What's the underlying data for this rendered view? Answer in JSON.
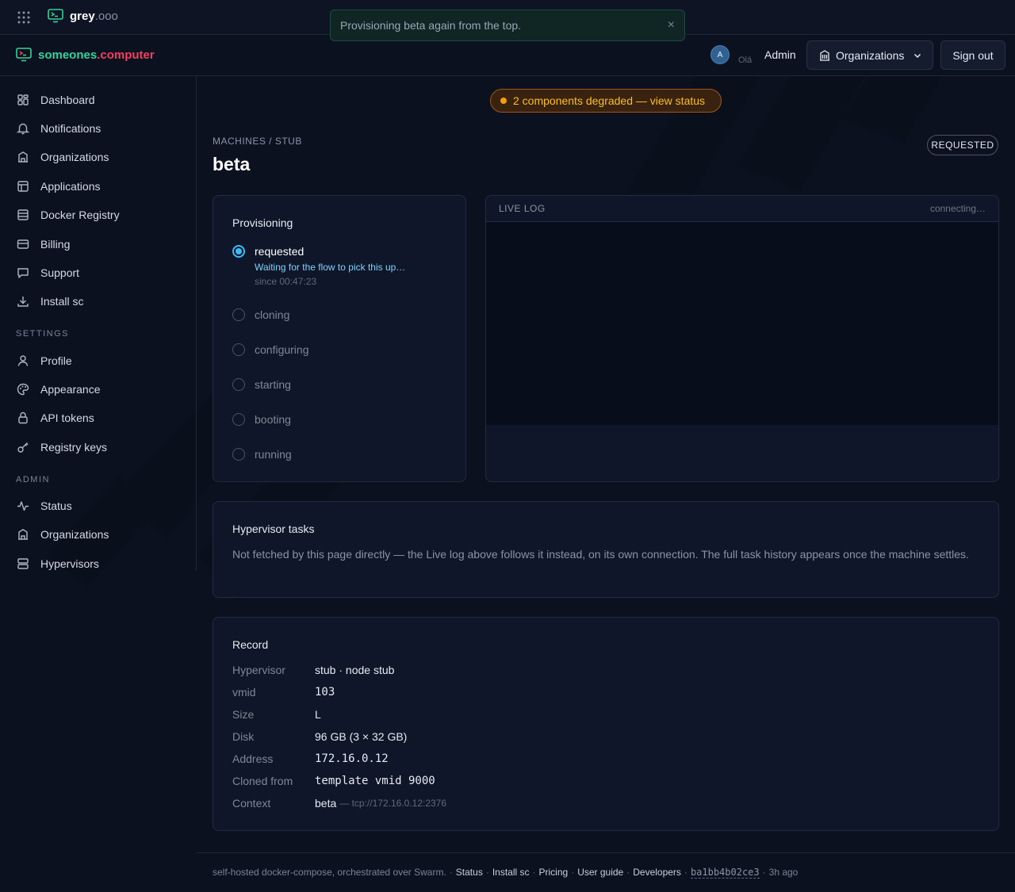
{
  "topbar": {
    "brand_name": "grey",
    "brand_ext": ".ooo",
    "toast_message": "Provisioning beta again from the top.",
    "toast_close": "×"
  },
  "header": {
    "brand_name": "someones",
    "brand_tld": ".computer",
    "avatar_initial": "A",
    "greeting": "Olá",
    "user_label": "Admin",
    "org_button": "Organizations",
    "signout_button": "Sign out"
  },
  "sidebar": {
    "items": [
      {
        "label": "Dashboard",
        "icon": "dashboard-icon"
      },
      {
        "label": "Notifications",
        "icon": "bell-icon"
      },
      {
        "label": "Organizations",
        "icon": "building-icon"
      },
      {
        "label": "Applications",
        "icon": "layout-icon"
      },
      {
        "label": "Docker Registry",
        "icon": "registry-icon"
      },
      {
        "label": "Billing",
        "icon": "card-icon"
      },
      {
        "label": "Support",
        "icon": "chat-icon"
      },
      {
        "label": "Install sc",
        "icon": "download-icon"
      }
    ],
    "settings_heading": "SETTINGS",
    "settings_items": [
      {
        "label": "Profile",
        "icon": "user-icon"
      },
      {
        "label": "Appearance",
        "icon": "palette-icon"
      },
      {
        "label": "API tokens",
        "icon": "lock-icon"
      },
      {
        "label": "Registry keys",
        "icon": "key-icon"
      }
    ],
    "admin_heading": "ADMIN",
    "admin_items": [
      {
        "label": "Status",
        "icon": "activity-icon"
      },
      {
        "label": "Organizations",
        "icon": "building-icon"
      },
      {
        "label": "Hypervisors",
        "icon": "server-icon"
      }
    ]
  },
  "main": {
    "degraded_banner": "2 components degraded — view status",
    "breadcrumb": "MACHINES / STUB",
    "title": "beta",
    "status_badge": "REQUESTED",
    "provisioning": {
      "title": "Provisioning",
      "steps": [
        {
          "label": "requested",
          "active": true
        },
        {
          "label": "cloning",
          "active": false
        },
        {
          "label": "configuring",
          "active": false
        },
        {
          "label": "starting",
          "active": false
        },
        {
          "label": "booting",
          "active": false
        },
        {
          "label": "running",
          "active": false
        }
      ],
      "active_detail": "Waiting for the flow to pick this up…",
      "active_since": "since 00:47:23"
    },
    "live_log": {
      "label": "LIVE LOG",
      "status": "connecting…"
    },
    "hypervisor_tasks": {
      "title": "Hypervisor tasks",
      "text": "Not fetched by this page directly — the Live log above follows it instead, on its own connection. The full task history appears once the machine settles."
    },
    "record": {
      "title": "Record",
      "rows": [
        {
          "key": "Hypervisor",
          "value": "stub · node stub",
          "mono": false,
          "sub": ""
        },
        {
          "key": "vmid",
          "value": "103",
          "mono": true,
          "sub": ""
        },
        {
          "key": "Size",
          "value": "L",
          "mono": false,
          "sub": ""
        },
        {
          "key": "Disk",
          "value": "96 GB (3 × 32 GB)",
          "mono": false,
          "sub": ""
        },
        {
          "key": "Address",
          "value": "172.16.0.12",
          "mono": true,
          "sub": ""
        },
        {
          "key": "Cloned from",
          "value": "template vmid 9000",
          "mono": true,
          "sub": ""
        },
        {
          "key": "Context",
          "value": "beta",
          "mono": false,
          "sub": "— tcp://172.16.0.12:2376"
        }
      ]
    }
  },
  "footer": {
    "tagline": "self-hosted docker-compose, orchestrated over Swarm.",
    "links": [
      "Status",
      "Install sc",
      "Pricing",
      "User guide",
      "Developers"
    ],
    "commit": "ba1bb4b02ce3",
    "age": "3h ago",
    "separator": "·"
  },
  "colors": {
    "background": "#0c1120",
    "accent_green": "#34d399",
    "accent_red": "#f43f5e",
    "active_blue": "#38bdf8",
    "warning": "#f59e0b"
  }
}
